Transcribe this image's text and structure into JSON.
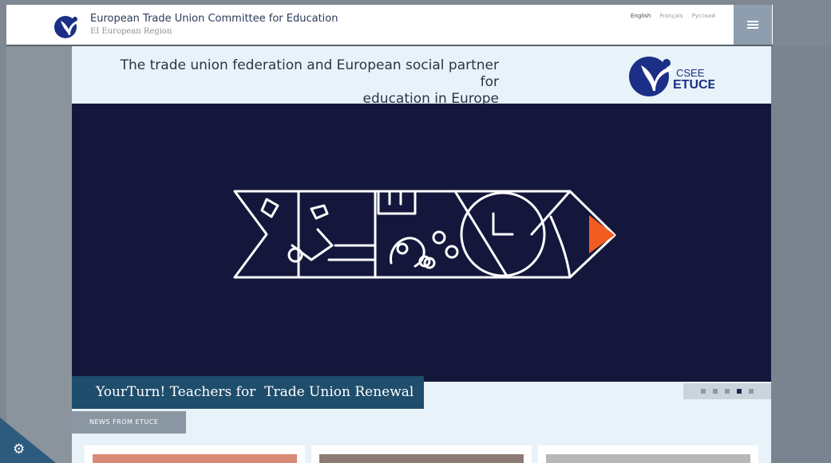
{
  "header": {
    "org_name": "European Trade Union Committee for Education",
    "org_region": "EI European Region",
    "languages": [
      "English",
      "Français",
      "Русский"
    ],
    "active_language": "English",
    "menu_icon": "hamburger-icon"
  },
  "hero": {
    "tagline_line1": "The trade union federation and European social partner for",
    "tagline_line2": "education in Europe",
    "brand_text_top": "CSEE",
    "brand_text_bottom": "ETUCE"
  },
  "slider": {
    "caption": "YourTurn! Teachers for  Trade Union Renewal",
    "dot_count": 5,
    "active_dot": 4,
    "banner_color": "#14173b",
    "accent_color": "#f25c1f"
  },
  "news": {
    "section_label": "NEWS FROM ETUCE"
  },
  "settings": {
    "icon": "gear-icon"
  }
}
